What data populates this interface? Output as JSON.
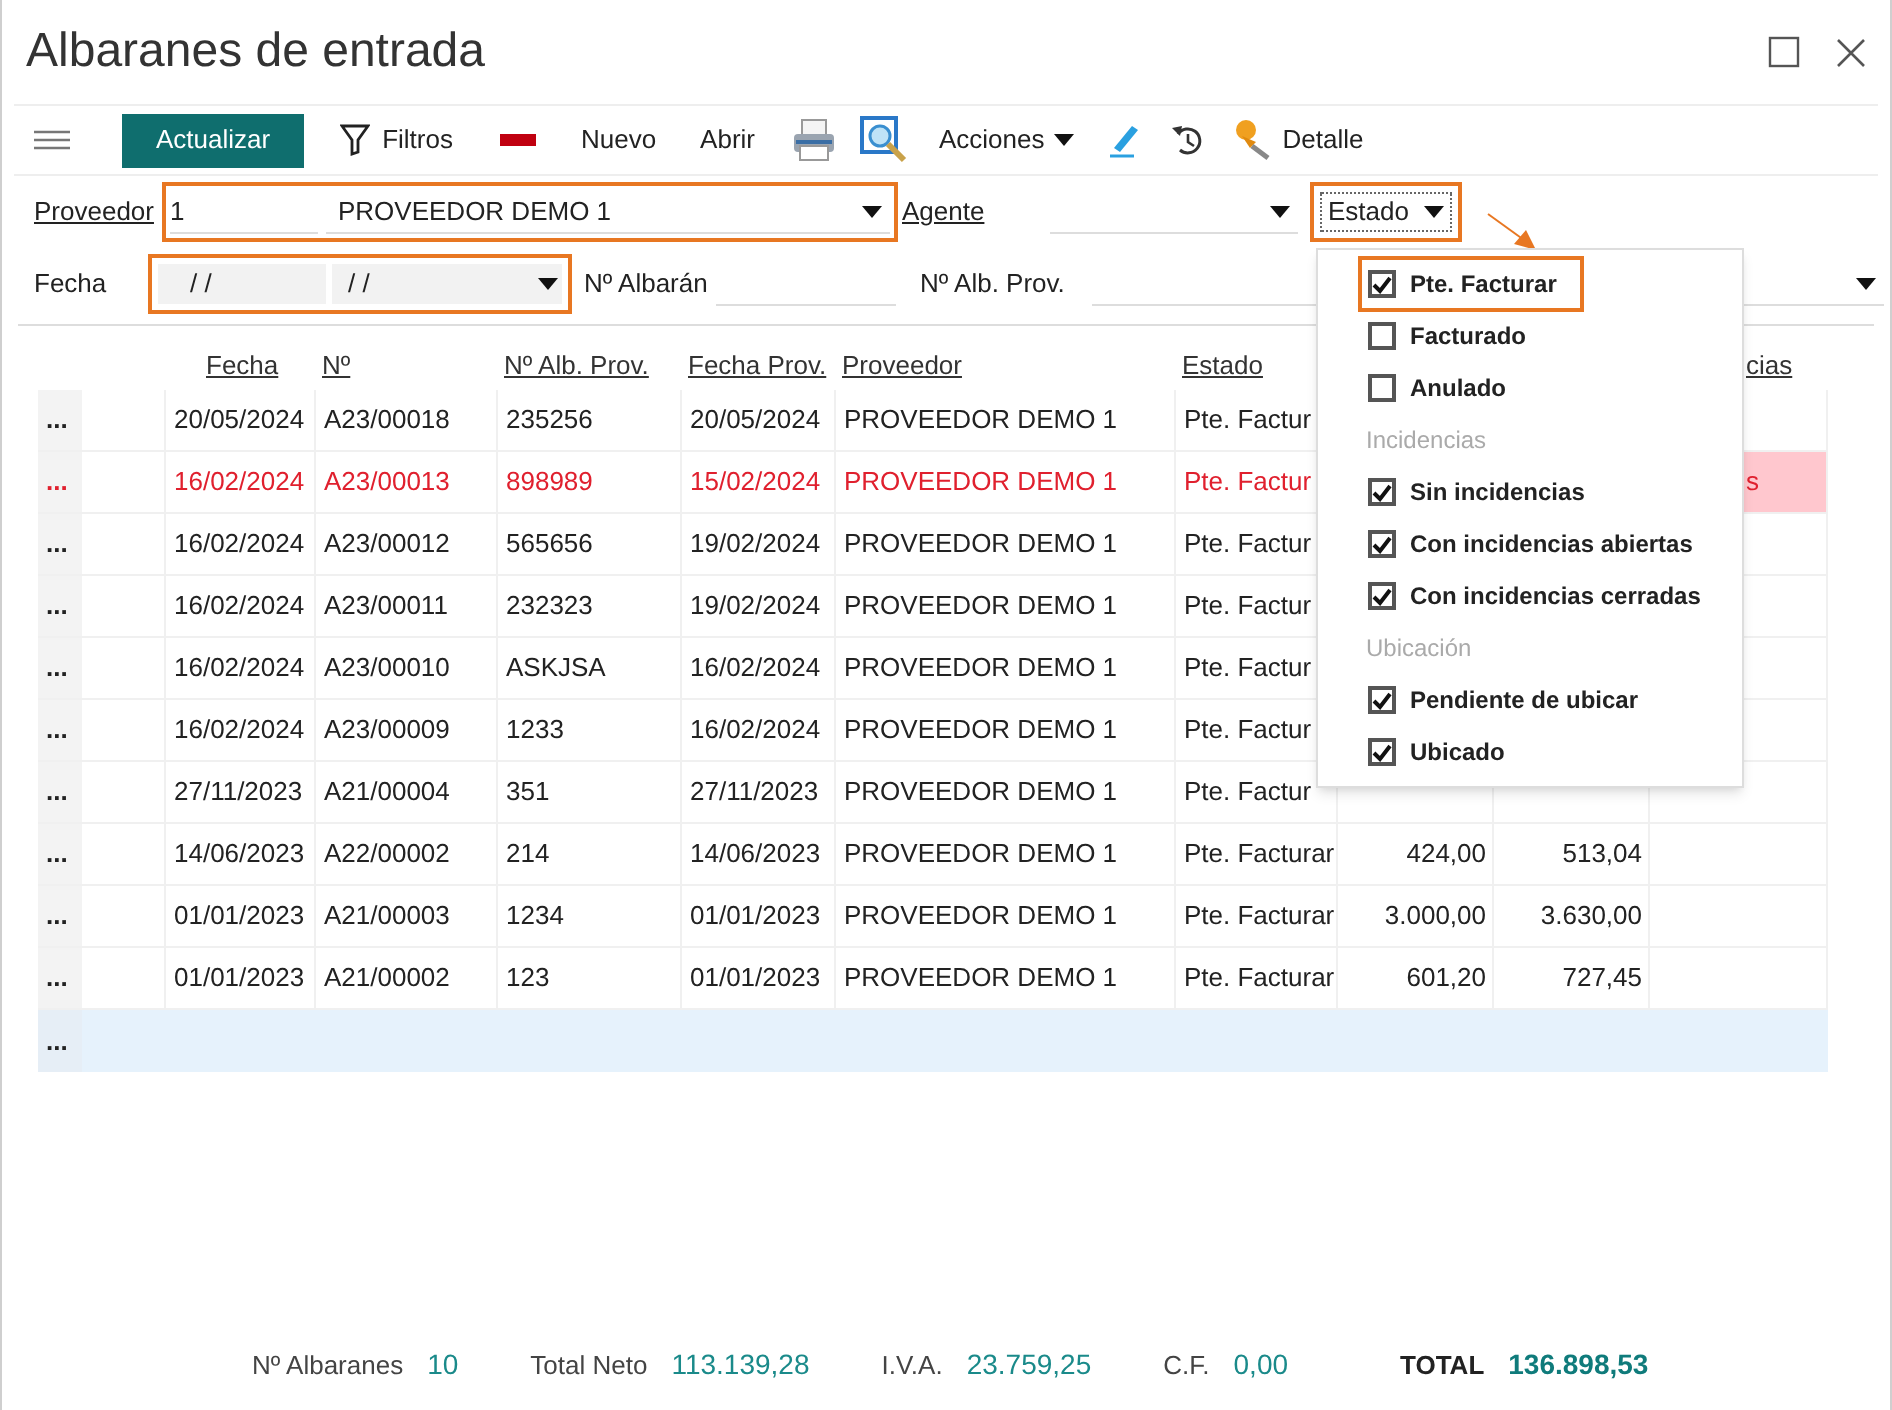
{
  "window": {
    "title": "Albaranes de entrada"
  },
  "toolbar": [
    {
      "kind": "menu"
    },
    {
      "kind": "primary",
      "label": "Actualizar"
    },
    {
      "kind": "filter",
      "label": "Filtros"
    },
    {
      "kind": "minus"
    },
    {
      "kind": "text",
      "label": "Nuevo"
    },
    {
      "kind": "text",
      "label": "Abrir"
    },
    {
      "kind": "printer"
    },
    {
      "kind": "preview"
    },
    {
      "kind": "dropdown",
      "label": "Acciones"
    },
    {
      "kind": "pencil"
    },
    {
      "kind": "undo"
    },
    {
      "kind": "pin",
      "label": "Detalle"
    }
  ],
  "filters": {
    "proveedor": {
      "label": "Proveedor",
      "code": "1",
      "name": "PROVEEDOR DEMO 1",
      "annotated": true
    },
    "agente": {
      "label": "Agente"
    },
    "estado": {
      "label": "Estado",
      "annotated": true
    },
    "fecha": {
      "label": "Fecha",
      "from": "/ /",
      "to": "/ /",
      "annotated": true
    },
    "albaran": {
      "label": "Nº Albarán"
    },
    "alb_prov": {
      "label": "Nº Alb. Prov."
    }
  },
  "table": {
    "columns": [
      {
        "label": "Fecha"
      },
      {
        "label": "Nº"
      },
      {
        "label": "Nº Alb. Prov."
      },
      {
        "label": "Fecha Prov."
      },
      {
        "label": "Proveedor"
      },
      {
        "label": "Estado"
      },
      {},
      {},
      {
        "label": "cias"
      }
    ],
    "rows": [
      {
        "marker": "...",
        "cells": [
          "20/05/2024",
          "A23/00018",
          "235256",
          "20/05/2024",
          "PROVEEDOR DEMO 1",
          "Pte. Factur"
        ],
        "alert": false
      },
      {
        "marker": "...",
        "cells": [
          "16/02/2024",
          "A23/00013",
          "898989",
          "15/02/2024",
          "PROVEEDOR DEMO 1",
          "Pte. Factur",
          null,
          null,
          "s"
        ],
        "alert": true
      },
      {
        "marker": "...",
        "cells": [
          "16/02/2024",
          "A23/00012",
          "565656",
          "19/02/2024",
          "PROVEEDOR DEMO 1",
          "Pte. Factur"
        ],
        "alert": false
      },
      {
        "marker": "...",
        "cells": [
          "16/02/2024",
          "A23/00011",
          "232323",
          "19/02/2024",
          "PROVEEDOR DEMO 1",
          "Pte. Factur"
        ],
        "alert": false
      },
      {
        "marker": "...",
        "cells": [
          "16/02/2024",
          "A23/00010",
          "ASKJSA",
          "16/02/2024",
          "PROVEEDOR DEMO 1",
          "Pte. Factur"
        ],
        "alert": false
      },
      {
        "marker": "...",
        "cells": [
          "16/02/2024",
          "A23/00009",
          "1233",
          "16/02/2024",
          "PROVEEDOR DEMO 1",
          "Pte. Factur"
        ],
        "alert": false
      },
      {
        "marker": "...",
        "cells": [
          "27/11/2023",
          "A21/00004",
          "351",
          "27/11/2023",
          "PROVEEDOR DEMO 1",
          "Pte. Factur"
        ],
        "alert": false
      },
      {
        "marker": "...",
        "cells": [
          "14/06/2023",
          "A22/00002",
          "214",
          "14/06/2023",
          "PROVEEDOR DEMO 1",
          "Pte. Facturar",
          "424,00",
          "513,04"
        ],
        "alert": false
      },
      {
        "marker": "...",
        "cells": [
          "01/01/2023",
          "A21/00003",
          "1234",
          "01/01/2023",
          "PROVEEDOR DEMO 1",
          "Pte. Facturar",
          "3.000,00",
          "3.630,00"
        ],
        "alert": false
      },
      {
        "marker": "...",
        "cells": [
          "01/01/2023",
          "A21/00002",
          "123",
          "01/01/2023",
          "PROVEEDOR DEMO 1",
          "Pte. Facturar",
          "601,20",
          "727,45"
        ],
        "alert": false
      }
    ],
    "new_row": {
      "marker": "..."
    }
  },
  "estado_menu": [
    {
      "kind": "checkbox",
      "label": "Pte. Facturar",
      "checked": true,
      "annotated": true
    },
    {
      "kind": "checkbox",
      "label": "Facturado",
      "checked": false,
      "annotated": false
    },
    {
      "kind": "checkbox",
      "label": "Anulado",
      "checked": false,
      "annotated": false
    },
    {
      "kind": "heading",
      "label": "Incidencias"
    },
    {
      "kind": "checkbox",
      "label": "Sin incidencias",
      "checked": true,
      "annotated": false
    },
    {
      "kind": "checkbox",
      "label": "Con incidencias abiertas",
      "checked": true,
      "annotated": false
    },
    {
      "kind": "checkbox",
      "label": "Con incidencias cerradas",
      "checked": true,
      "annotated": false
    },
    {
      "kind": "heading",
      "label": "Ubicación"
    },
    {
      "kind": "checkbox",
      "label": "Pendiente de ubicar",
      "checked": true,
      "annotated": false
    },
    {
      "kind": "checkbox",
      "label": "Ubicado",
      "checked": true,
      "annotated": false
    }
  ],
  "totals": [
    {
      "label": "Nº Albaranes",
      "value": "10",
      "kind": "normal"
    },
    {
      "label": "Total Neto",
      "value": "113.139,28",
      "kind": "normal"
    },
    {
      "label": "I.V.A.",
      "value": "23.759,25",
      "kind": "normal"
    },
    {
      "label": "C.F.",
      "value": "0,00",
      "kind": "normal"
    },
    {
      "label": "TOTAL",
      "value": "136.898,53",
      "kind": "grand"
    }
  ]
}
